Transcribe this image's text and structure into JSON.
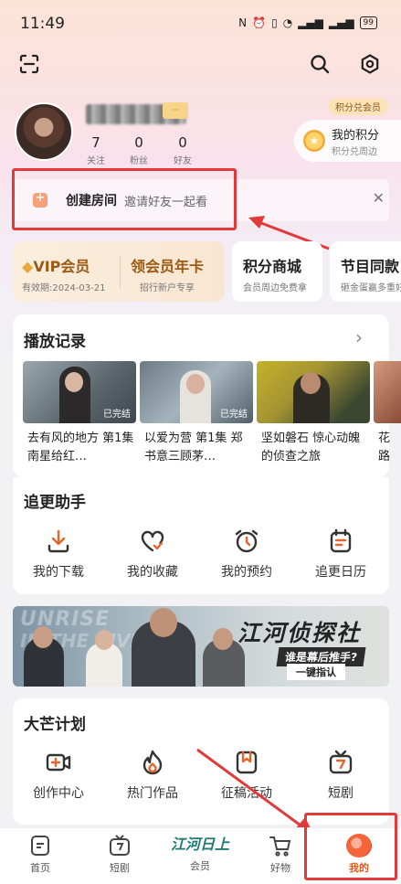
{
  "status_bar": {
    "time": "11:49",
    "battery": "99"
  },
  "profile": {
    "stats": [
      {
        "value": "7",
        "label": "关注"
      },
      {
        "value": "0",
        "label": "粉丝"
      },
      {
        "value": "0",
        "label": "好友"
      }
    ],
    "points_tag": "积分兑会员",
    "points_title": "我的积分",
    "points_sub": "积分兑周边"
  },
  "room": {
    "title": "创建房间",
    "subtitle": "邀请好友一起看"
  },
  "cards": {
    "vip_title": "VIP会员",
    "vip_sub": "有效期:2024-03-21",
    "year_title": "领会员年卡",
    "year_sub": "招行新户专享",
    "mall_title": "积分商城",
    "mall_sub": "会员周边免费拿",
    "show_title": "节目同款",
    "show_sub": "砸金蛋赢多重好"
  },
  "history": {
    "title": "播放记录",
    "items": [
      {
        "title": "去有风的地方 第1集 南星给红…",
        "tag": "已完结"
      },
      {
        "title": "以爱为营 第1集 郑书意三顾茅…",
        "tag": "已完结"
      },
      {
        "title": "坚如磐石 惊心动魄的侦查之旅",
        "tag": ""
      },
      {
        "title": "花路",
        "tag": ""
      }
    ]
  },
  "helper": {
    "title": "追更助手",
    "tools": [
      {
        "label": "我的下载",
        "icon": "download-icon"
      },
      {
        "label": "我的收藏",
        "icon": "heart-icon"
      },
      {
        "label": "我的预约",
        "icon": "alarm-icon"
      },
      {
        "label": "追更日历",
        "icon": "calendar-icon"
      }
    ]
  },
  "banner": {
    "bg_text_1": "UNRISE",
    "bg_text_2": "IN THE RIVER",
    "title": "江河侦探社",
    "question": "谁是幕后推手?",
    "cta": "一键指认"
  },
  "mango_plan": {
    "title": "大芒计划",
    "tools": [
      {
        "label": "创作中心",
        "icon": "video-plus-icon"
      },
      {
        "label": "热门作品",
        "icon": "flame-icon"
      },
      {
        "label": "征稿活动",
        "icon": "bookmark-icon"
      },
      {
        "label": "短剧",
        "icon": "tv-icon"
      }
    ]
  },
  "bottom_nav": {
    "items": [
      {
        "label": "首页"
      },
      {
        "label": "短剧"
      },
      {
        "label": "会员",
        "logo": "江河日上"
      },
      {
        "label": "好物"
      },
      {
        "label": "我的"
      }
    ]
  },
  "colors": {
    "accent": "#e05a1a",
    "annotation": "#e23a3a",
    "vip_gold": "#9b5a14"
  }
}
